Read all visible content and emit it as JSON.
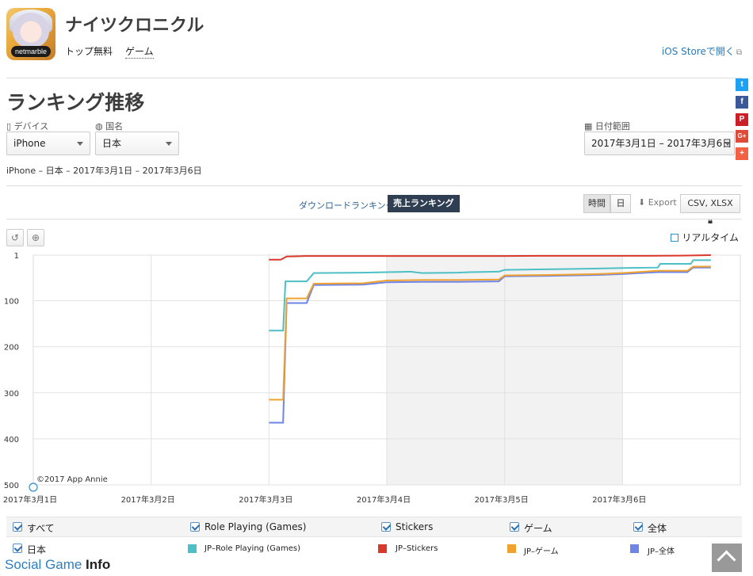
{
  "header": {
    "app_title": "ナイツクロニクル",
    "app_icon_text": "netmarble",
    "price_label": "トップ無料",
    "category_label": "ゲーム",
    "store_link": "iOS Storeで開く"
  },
  "social": [
    "twitter-icon",
    "facebook-icon",
    "pinterest-icon",
    "google-plus-icon",
    "share-plus-icon"
  ],
  "section": {
    "title": "ランキング推移",
    "device_label": "デバイス",
    "device_value": "iPhone",
    "country_label": "国名",
    "country_value": "日本",
    "date_label": "日付範囲",
    "date_value": "2017年3月1日 – 2017年3月6日",
    "summary": "iPhone – 日本 – 2017年3月1日 – 2017年3月6日"
  },
  "toolbar": {
    "tab_download": "ダウンロードランキング",
    "tab_sales": "売上ランキング",
    "granularity_hour": "時間",
    "granularity_day": "日",
    "export_label": "Export",
    "format_label": "CSV, XLSX",
    "realtime_label": "リアルタイム"
  },
  "chart_data": {
    "type": "line",
    "copyright": "©2017 App Annie",
    "y_reversed": true,
    "ylim": [
      1,
      500
    ],
    "yticks": [
      "1",
      "100",
      "200",
      "300",
      "400",
      "500"
    ],
    "xticks": [
      "2017年3月1日",
      "2017年3月2日",
      "2017年3月3日",
      "2017年3月4日",
      "2017年3月5日",
      "2017年3月6日"
    ],
    "shaded_days": [
      3,
      4
    ],
    "series": [
      {
        "name": "JP-Stickers",
        "color": "#d9392b",
        "x": [
          2.0,
          2.1,
          2.15,
          2.3,
          3.0,
          4.0,
          4.3,
          5.0,
          5.2,
          5.5,
          5.75
        ],
        "y": [
          11,
          11,
          4,
          3,
          3,
          3,
          2.5,
          2.5,
          2.5,
          2,
          1
        ]
      },
      {
        "name": "JP-Role Playing (Games)",
        "color": "#4dbfc6",
        "x": [
          2.0,
          2.12,
          2.14,
          2.32,
          2.38,
          2.8,
          3.0,
          3.2,
          3.3,
          3.6,
          3.7,
          3.95,
          4.0,
          4.3,
          4.6,
          4.8,
          5.0,
          5.3,
          5.32,
          5.58,
          5.6,
          5.75
        ],
        "y": [
          165,
          165,
          58,
          58,
          40,
          39,
          38,
          37,
          40,
          39,
          38,
          37,
          33,
          32,
          31,
          30,
          29,
          28,
          20,
          20,
          12,
          12
        ]
      },
      {
        "name": "JP-ゲーム",
        "color": "#f0a22e",
        "x": [
          2.0,
          2.12,
          2.15,
          2.32,
          2.38,
          2.8,
          3.0,
          3.3,
          3.6,
          3.95,
          4.0,
          4.4,
          4.8,
          5.0,
          5.3,
          5.55,
          5.6,
          5.75
        ],
        "y": [
          315,
          315,
          95,
          95,
          63,
          62,
          56,
          55,
          55,
          54,
          45,
          44,
          42,
          40,
          35,
          35,
          26,
          26
        ]
      },
      {
        "name": "JP-全体",
        "color": "#6e84e6",
        "x": [
          2.0,
          2.12,
          2.15,
          2.32,
          2.38,
          2.8,
          3.0,
          3.3,
          3.6,
          3.95,
          4.0,
          4.4,
          4.8,
          5.0,
          5.3,
          5.55,
          5.6,
          5.75
        ],
        "y": [
          365,
          365,
          105,
          105,
          66,
          65,
          60,
          59,
          59,
          58,
          47,
          46,
          44,
          42,
          38,
          38,
          28,
          28
        ]
      }
    ]
  },
  "legend": {
    "row1": [
      "すべて",
      "Role Playing (Games)",
      "Stickers",
      "ゲーム",
      "全体"
    ],
    "country": "日本",
    "series_names": [
      "JP–Role Playing (Games)",
      "JP–Stickers",
      "JP–ゲーム",
      "JP–全体"
    ],
    "series_colors": [
      "#4dbfc6",
      "#d9392b",
      "#f0a22e",
      "#6e84e6"
    ]
  },
  "watermark": {
    "prefix": "Social Game ",
    "suffix": "Info"
  }
}
